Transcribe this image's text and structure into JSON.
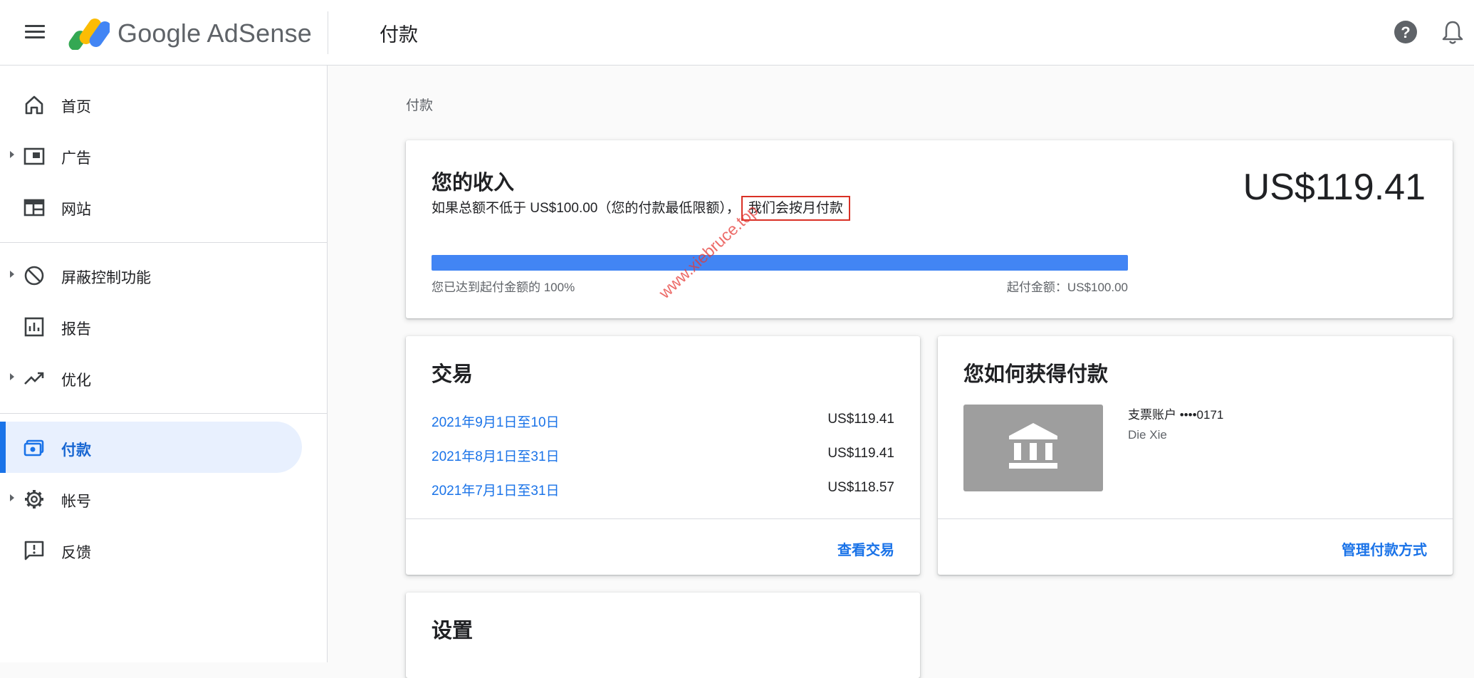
{
  "app": {
    "brand": "Google AdSense",
    "page_title": "付款"
  },
  "sidebar": {
    "items": [
      {
        "label": "首页",
        "icon": "home-icon"
      },
      {
        "label": "广告",
        "icon": "ads-icon"
      },
      {
        "label": "网站",
        "icon": "sites-icon"
      },
      {
        "label": "屏蔽控制功能",
        "icon": "block-icon"
      },
      {
        "label": "报告",
        "icon": "reports-icon"
      },
      {
        "label": "优化",
        "icon": "trending-up-icon"
      },
      {
        "label": "付款",
        "icon": "payments-icon",
        "active": true
      },
      {
        "label": "帐号",
        "icon": "gear-icon"
      },
      {
        "label": "反馈",
        "icon": "feedback-icon"
      }
    ]
  },
  "breadcrumb": "付款",
  "income": {
    "title": "您的收入",
    "description_prefix": "如果总额不低于 US$100.00（您的付款最低限额），",
    "description_highlight": "我们会按月付款",
    "amount": "US$119.41",
    "progress_percent": 100,
    "progress_label": "您已达到起付金额的 100%",
    "threshold_label": "起付金额：US$100.00"
  },
  "transactions": {
    "title": "交易",
    "rows": [
      {
        "date": "2021年9月1日至10日",
        "amount": "US$119.41"
      },
      {
        "date": "2021年8月1日至31日",
        "amount": "US$119.41"
      },
      {
        "date": "2021年7月1日至31日",
        "amount": "US$118.57"
      }
    ],
    "link": "查看交易"
  },
  "payment_method": {
    "title": "您如何获得付款",
    "account": "支票账户 ••••0171",
    "name": "Die Xie",
    "link": "管理付款方式"
  },
  "settings": {
    "title": "设置"
  },
  "watermark": "www.xiebruce.top",
  "colors": {
    "accent": "#1a73e8",
    "progress": "#4285f4",
    "highlight_border": "#d93025",
    "active_nav_bg": "#e8f0fe"
  }
}
